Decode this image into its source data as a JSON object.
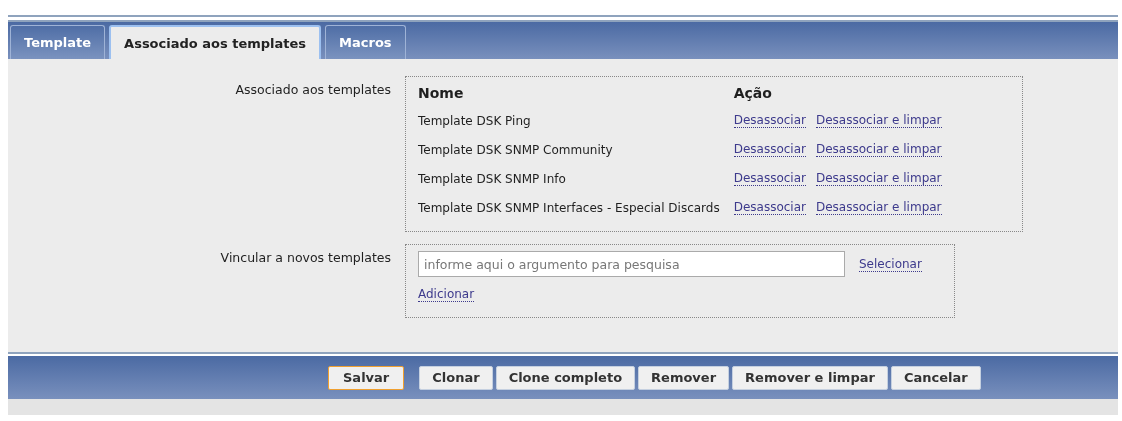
{
  "tabs": [
    {
      "label": "Template",
      "selected": false
    },
    {
      "label": "Associado aos templates",
      "selected": true
    },
    {
      "label": "Macros",
      "selected": false
    }
  ],
  "linked": {
    "label": "Associado aos templates",
    "columns": [
      "Nome",
      "Ação"
    ],
    "rows": [
      {
        "name": "Template DSK Ping",
        "actions": [
          "Desassociar",
          "Desassociar e limpar"
        ]
      },
      {
        "name": "Template DSK SNMP Community",
        "actions": [
          "Desassociar",
          "Desassociar e limpar"
        ]
      },
      {
        "name": "Template DSK SNMP Info",
        "actions": [
          "Desassociar",
          "Desassociar e limpar"
        ]
      },
      {
        "name": "Template DSK SNMP Interfaces - Especial Discards",
        "actions": [
          "Desassociar",
          "Desassociar e limpar"
        ]
      }
    ]
  },
  "link_new": {
    "label": "Vincular a novos templates",
    "placeholder": "informe aqui o argumento para pesquisa",
    "select_link": "Selecionar",
    "add_link": "Adicionar"
  },
  "buttons": [
    {
      "label": "Salvar",
      "primary": true
    },
    {
      "label": "Clonar",
      "primary": false
    },
    {
      "label": "Clone completo",
      "primary": false
    },
    {
      "label": "Remover",
      "primary": false
    },
    {
      "label": "Remover e limpar",
      "primary": false
    },
    {
      "label": "Cancelar",
      "primary": false
    }
  ]
}
